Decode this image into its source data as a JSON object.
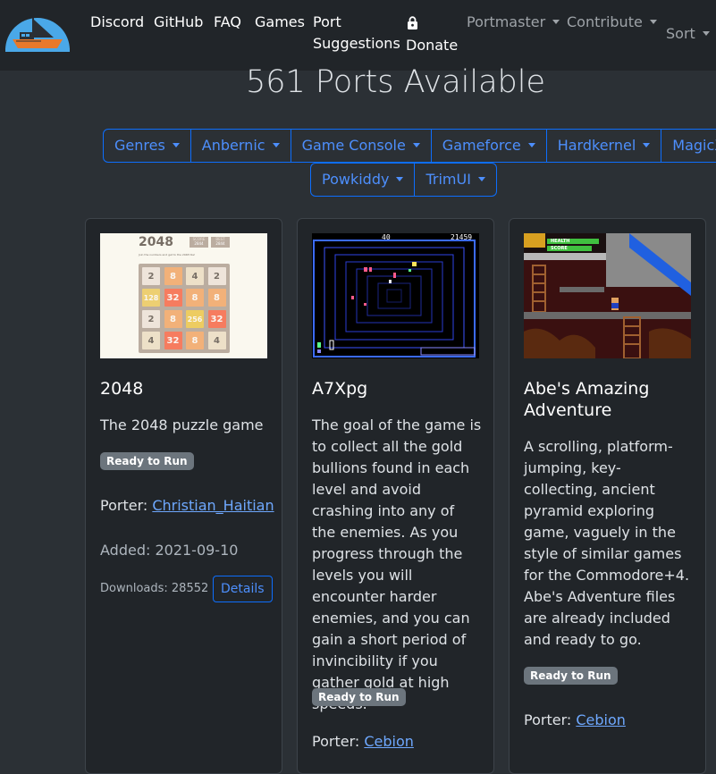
{
  "nav": {
    "links": [
      "Discord",
      "GitHub",
      "FAQ",
      "Games"
    ],
    "port_suggestions": [
      "Port",
      "Suggestions"
    ],
    "donate": "Donate",
    "portmaster": "Portmaster",
    "contribute": "Contribute",
    "sort": "Sort"
  },
  "heading": "561 Ports Available",
  "filters": {
    "row1": [
      "Genres",
      "Anbernic",
      "Game Console",
      "Gameforce",
      "Hardkernel",
      "MagicX"
    ],
    "row2": [
      "Powkiddy",
      "TrimUI"
    ]
  },
  "cards": [
    {
      "title": "2048",
      "description": "The 2048 puzzle game",
      "badge": "Ready to Run",
      "porter_label": "Porter:",
      "porter": "Christian_Haitian",
      "added": "Added: 2021-09-10",
      "downloads": "Downloads: 28552",
      "details": "Details",
      "thumb": {
        "title": "2048",
        "score_label": "SCORE",
        "score": "2844",
        "best_label": "BEST",
        "best": "2844",
        "subtitle": "Join the numbers and get to the 2048 tile!",
        "grid": [
          "2",
          "8",
          "4",
          "2",
          "128",
          "32",
          "8",
          "8",
          "2",
          "8",
          "256",
          "32",
          "4",
          "32",
          "8",
          "4"
        ]
      }
    },
    {
      "title": "A7Xpg",
      "description": "The goal of the game is to collect all the gold bullions found in each level and avoid crashing into any of the enemies. As you progress through the levels you will encounter harder enemies, and you can gain a short period of invincibility if you gather gold at high speeds.",
      "badge": "Ready to Run",
      "porter_label": "Porter:",
      "porter": "Cebion",
      "thumb": {
        "hud_left": "40",
        "hud_right": "21459"
      }
    },
    {
      "title_lines": [
        "Abe's Amazing",
        "Adventure"
      ],
      "description": "A scrolling, platform-jumping, key-collecting, ancient pyramid exploring game, vaguely in the style of similar games for the Commodore+4. Abe's Adventure files are already included and ready to go.",
      "badge": "Ready to Run",
      "porter_label": "Porter:",
      "porter": "Cebion",
      "thumb": {
        "health_label": "HEALTH",
        "score_label": "SCORE"
      }
    }
  ],
  "colors": {
    "navbar_bg": "#212529",
    "page_bg": "#2b3035",
    "card_bg": "#212529",
    "primary": "#0d6efd",
    "link": "#6ea8fe",
    "badge": "#6c757d"
  }
}
